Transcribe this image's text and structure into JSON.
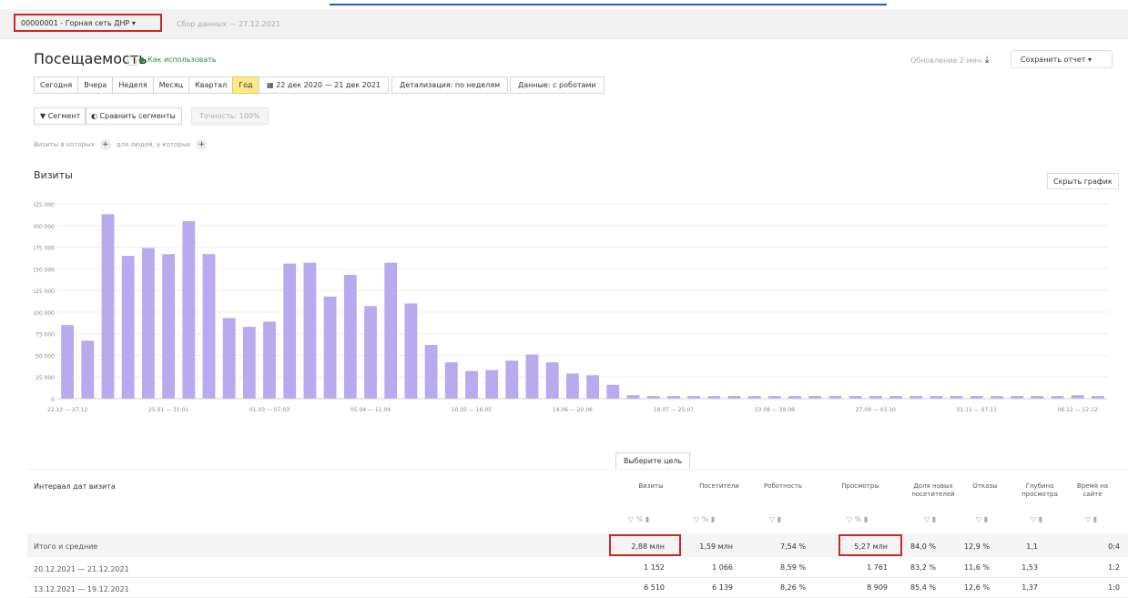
{
  "header": {
    "counter_label": "00000001 - Горная сеть ДНР",
    "counter_sub": "Сбор данных — 27.12.2021"
  },
  "page": {
    "title": "Посещаемость",
    "how_to_use": "Как использовать",
    "data_status": "Обновление 2 мин.",
    "save_report": "Сохранить отчет"
  },
  "period": {
    "buttons": [
      "Сегодня",
      "Вчера",
      "Неделя",
      "Месяц",
      "Квартал",
      "Год"
    ],
    "active_index": 5,
    "date_range": "22 дек 2020 — 21 дек 2021",
    "detail": "Детализация: по неделям",
    "robots": "Данные: с роботами"
  },
  "filters": {
    "segment": "Сегмент",
    "compare": "Сравнить сегменты",
    "sample": "Точность: 100%"
  },
  "grouping": {
    "visits_label": "Визиты в которых",
    "for_whom_label": "для людей, у которых"
  },
  "chart": {
    "title": "Визиты",
    "hide_label": "Скрыть график"
  },
  "chart_data": {
    "type": "bar",
    "title": "Визиты",
    "ylim": [
      0,
      225000
    ],
    "yticks": [
      "0",
      "25 000",
      "50 000",
      "75 000",
      "100 000",
      "125 000",
      "150 000",
      "175 000",
      "200 000",
      "225 000"
    ],
    "xtick_labels": [
      "22.12 — 27.12",
      "25.01 — 31.01",
      "01.03 — 07.03",
      "05.04 — 11.04",
      "10.05 — 16.05",
      "14.06 — 20.06",
      "19.07 — 25.07",
      "23.08 — 29.08",
      "27.09 — 03.10",
      "01.11 — 07.11",
      "06.12 — 12.12"
    ],
    "color": "#b9a9ee",
    "values": [
      85000,
      67000,
      213000,
      165000,
      174000,
      167000,
      205000,
      167000,
      93000,
      83000,
      89000,
      156000,
      157000,
      118000,
      143000,
      107000,
      157000,
      110000,
      62000,
      42000,
      32000,
      33000,
      44000,
      51000,
      42000,
      29000,
      27000,
      16000,
      4000,
      3000,
      3000,
      3000,
      3000,
      3000,
      3000,
      3000,
      3000,
      3000,
      3000,
      3000,
      3000,
      3000,
      3000,
      3000,
      3000,
      3000,
      3000,
      3000,
      3000,
      3000,
      4000,
      3000
    ]
  },
  "table": {
    "goal_select": "Выберите цель",
    "dimension_header": "Интервал дат визита",
    "columns": [
      "Визиты",
      "Посетители",
      "Роботность",
      "Просмотры",
      "Доля новых посетителей",
      "Отказы",
      "Глубина просмотра",
      "Время на сайте"
    ],
    "total_label": "Итого и средние",
    "totals": [
      "2,88 млн",
      "1,59 млн",
      "7,54 %",
      "5,27 млн",
      "84,0 %",
      "12,9 %",
      "1,1",
      "0:4"
    ],
    "rows": [
      {
        "label": "20.12.2021 — 21.12.2021",
        "values": [
          "1 152",
          "1 066",
          "8,59 %",
          "1 761",
          "83,2 %",
          "11,6 %",
          "1,53",
          "1:2"
        ]
      },
      {
        "label": "13.12.2021 — 19.12.2021",
        "values": [
          "6 510",
          "6 139",
          "8,26 %",
          "8 909",
          "85,4 %",
          "12,6 %",
          "1,37",
          "1:0"
        ]
      }
    ]
  }
}
